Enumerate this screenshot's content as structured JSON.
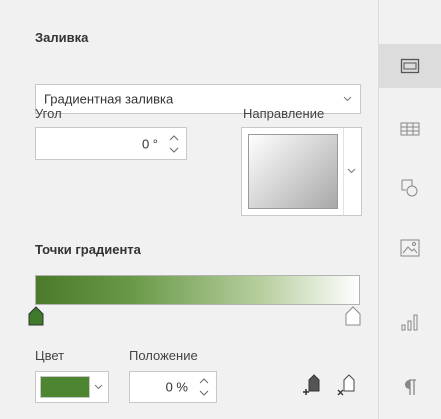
{
  "fill": {
    "title": "Заливка",
    "type_value": "Градиентная заливка"
  },
  "angle": {
    "label": "Угол",
    "value": "0 °"
  },
  "direction": {
    "label": "Направление"
  },
  "gradient": {
    "title": "Точки градиента",
    "colors": [
      "#4a7a2a",
      "#ffffff"
    ]
  },
  "color": {
    "label": "Цвет",
    "value": "#4e8530"
  },
  "position": {
    "label": "Положение",
    "value": "0 %"
  },
  "sidebar": {
    "items": [
      {
        "name": "shape-settings-icon",
        "active": true
      },
      {
        "name": "table-settings-icon",
        "active": false
      },
      {
        "name": "shapes-settings-icon",
        "active": false
      },
      {
        "name": "image-settings-icon",
        "active": false
      },
      {
        "name": "chart-settings-icon",
        "active": false
      },
      {
        "name": "paragraph-settings-icon",
        "active": false
      }
    ]
  }
}
